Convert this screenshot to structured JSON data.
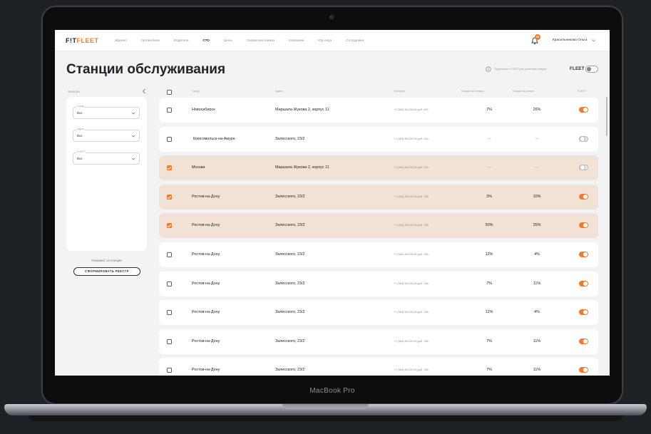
{
  "device": {
    "label": "MacBook Pro"
  },
  "nav": {
    "logo_prefix": "F!T",
    "logo_suffix": "FLEET",
    "items": [
      "Журнал",
      "Автомобили",
      "Водители",
      "СТО",
      "Цены",
      "Сервисная книжка",
      "Компании",
      "Юр.лица",
      "Сотрудники"
    ],
    "active_index": 3,
    "notification_count": "99",
    "user_name": "Красильникова Ольга"
  },
  "page": {
    "title": "Станции обслуживания",
    "info_text": "Подключите FLEET для установки скидок",
    "fleet_label": "FLEET",
    "fleet_toggle_on": false
  },
  "filters": {
    "header": "Фильтры",
    "fields": [
      {
        "legend": "Город",
        "value": "Все"
      },
      {
        "legend": "Адрес",
        "value": "Все"
      },
      {
        "legend": "FLEET",
        "value": "Все"
      }
    ],
    "shown_text": "Показано: 14 станции",
    "register_button": "СФОРМИРОВАТЬ РЕЕСТР"
  },
  "table": {
    "columns": [
      "Город",
      "Адрес",
      "Телефон",
      "Скидка на товары",
      "Скидка на услуги",
      "FLEET"
    ],
    "rows": [
      {
        "city": "Новосибирск",
        "address": "Маршала Жукова 2, корпус 11",
        "phone": "+7 (383) 363-59-55 доб. 944",
        "goods": "7%",
        "services": "26%",
        "fleet": true,
        "selected": false
      },
      {
        "city": "Комсомольск-на-Амуре",
        "address": "Залесского, 23/2",
        "phone": "+7 (383) 363-59-55 доб. 946",
        "goods": "—",
        "services": "—",
        "fleet": false,
        "selected": false
      },
      {
        "city": "Москва",
        "address": "Маршала Жукова 2, корпус 11",
        "phone": "+7 (383) 363-59-55 доб. 930",
        "goods": "—",
        "services": "—",
        "fleet": false,
        "selected": true
      },
      {
        "city": "Ростов-на-Дону",
        "address": "Залесского, 23/2",
        "phone": "+7 (383) 363-59-55 доб. 788",
        "goods": "3%",
        "services": "10%",
        "fleet": true,
        "selected": true
      },
      {
        "city": "Ростов-на-Дону",
        "address": "Залесского, 23/2",
        "phone": "+7 (383) 363-59-55 доб. 788",
        "goods": "50%",
        "services": "25%",
        "fleet": true,
        "selected": true
      },
      {
        "city": "Ростов-на-Дону",
        "address": "Залесского, 23/2",
        "phone": "+7 (383) 363-59-55 доб. 788",
        "goods": "12%",
        "services": "4%",
        "fleet": true,
        "selected": false
      },
      {
        "city": "Ростов-на-Дону",
        "address": "Залесского, 23/2",
        "phone": "+7 (383) 363-59-55 доб. 788",
        "goods": "7%",
        "services": "11%",
        "fleet": true,
        "selected": false
      },
      {
        "city": "Ростов-на-Дону",
        "address": "Залесского, 23/2",
        "phone": "+7 (383) 363-59-55 доб. 788",
        "goods": "12%",
        "services": "4%",
        "fleet": true,
        "selected": false
      },
      {
        "city": "Ростов-на-Дону",
        "address": "Залесского, 23/2",
        "phone": "+7 (383) 363-59-55 доб. 788",
        "goods": "7%",
        "services": "11%",
        "fleet": true,
        "selected": false
      },
      {
        "city": "Ростов-на-Дону",
        "address": "Залесского, 23/2",
        "phone": "+7 (383) 363-59-55 доб. 788",
        "goods": "7%",
        "services": "11%",
        "fleet": true,
        "selected": false
      }
    ]
  },
  "colors": {
    "accent": "#f07a2e",
    "selected_row": "#f2e1d5",
    "background": "#f1f3f4"
  }
}
